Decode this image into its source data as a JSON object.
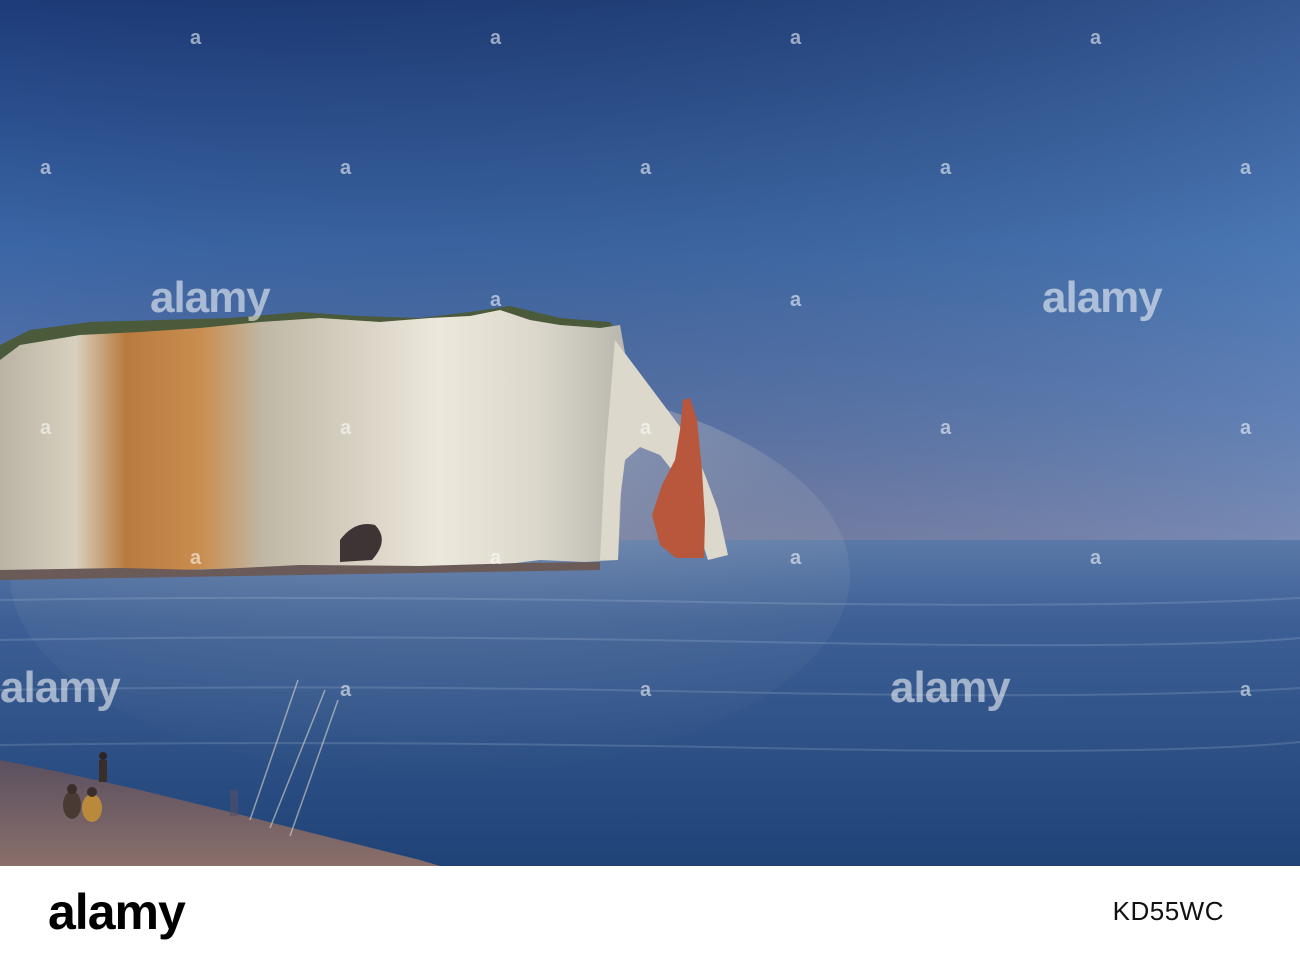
{
  "photo": {
    "alt_subject": "",
    "watermark_text": "alamy",
    "watermark_mark": "a"
  },
  "footer": {
    "logo": "alamy",
    "image_code": "KD55WC"
  },
  "colors": {
    "sky_top": "#1f3f7a",
    "sky_horizon": "#6f7fa8",
    "sea": "#2b4f84",
    "cliff_lit": "#d7d2c4",
    "cliff_orange": "#c4894a",
    "footer_bg": "#ffffff"
  }
}
